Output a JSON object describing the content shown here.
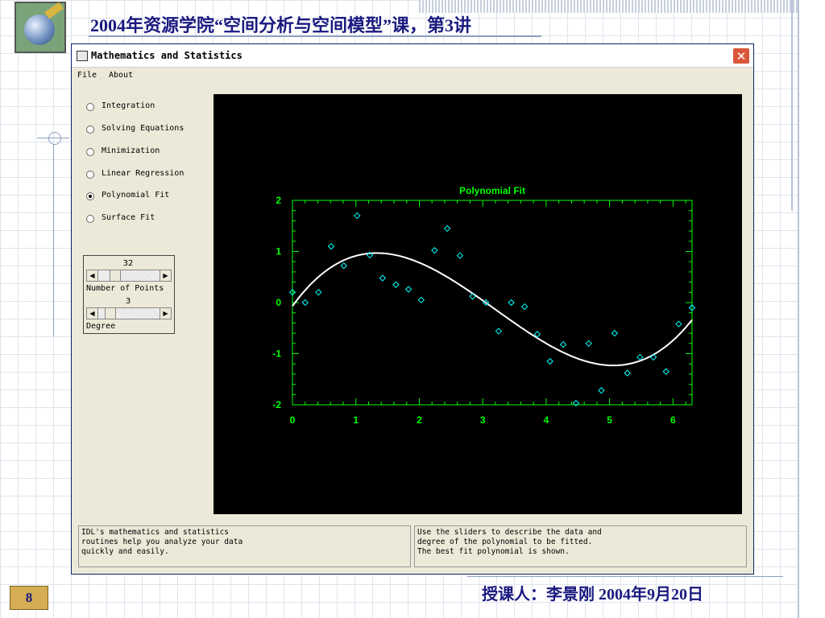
{
  "slide": {
    "title": "2004年资源学院“空间分析与空间模型”课，第3讲",
    "footer": "授课人：李景刚    2004年9月20日",
    "page_number": "8"
  },
  "window": {
    "title": "Mathematics and Statistics",
    "close_label": "✕",
    "menu": [
      "File",
      "About"
    ],
    "options": [
      {
        "label": "Integration",
        "selected": false
      },
      {
        "label": "Solving Equations",
        "selected": false
      },
      {
        "label": "Minimization",
        "selected": false
      },
      {
        "label": "Linear Regression",
        "selected": false
      },
      {
        "label": "Polynomial Fit",
        "selected": true
      },
      {
        "label": "Surface Fit",
        "selected": false
      }
    ],
    "sliders": {
      "points_value": "32",
      "points_label": "Number of Points",
      "degree_value": "3",
      "degree_label": "Degree",
      "left_arrow": "◀",
      "right_arrow": "▶"
    },
    "info_left": "IDL's mathematics and statistics\nroutines help you analyze your data\nquickly and easily.",
    "info_right": "Use the sliders to describe the data and\ndegree of the polynomial to be fitted.\nThe best fit polynomial is shown."
  },
  "chart_data": {
    "type": "scatter",
    "title": "Polynomial Fit",
    "xlim": [
      0,
      6.3
    ],
    "ylim": [
      -2,
      2
    ],
    "xticks": [
      0,
      1,
      2,
      3,
      4,
      5,
      6
    ],
    "yticks": [
      2,
      1,
      0,
      -1,
      -2
    ],
    "grid": false,
    "colors": {
      "axes": "#00ff00",
      "points": "#00ffff",
      "fit": "#ffffff",
      "title": "#00ff00",
      "background": "#000000"
    },
    "points": {
      "x": [
        0.0,
        0.2,
        0.41,
        0.61,
        0.81,
        1.02,
        1.22,
        1.42,
        1.63,
        1.83,
        2.03,
        2.24,
        2.44,
        2.64,
        2.84,
        3.05,
        3.25,
        3.45,
        3.66,
        3.86,
        4.06,
        4.27,
        4.47,
        4.67,
        4.87,
        5.08,
        5.28,
        5.48,
        5.69,
        5.89,
        6.09,
        6.3
      ],
      "y": [
        0.2,
        0.0,
        0.2,
        1.1,
        0.72,
        1.7,
        0.93,
        0.48,
        0.35,
        0.26,
        0.05,
        1.02,
        1.45,
        0.92,
        0.12,
        0.0,
        -0.56,
        0.0,
        -0.08,
        -0.62,
        -1.15,
        -0.82,
        -1.97,
        -0.8,
        -1.72,
        -0.6,
        -1.38,
        -1.07,
        -1.07,
        -1.35,
        -0.42,
        -0.1
      ]
    },
    "fit": {
      "degree": 3,
      "description": "best fit cubic polynomial",
      "x_range": [
        0,
        6.3
      ]
    }
  }
}
